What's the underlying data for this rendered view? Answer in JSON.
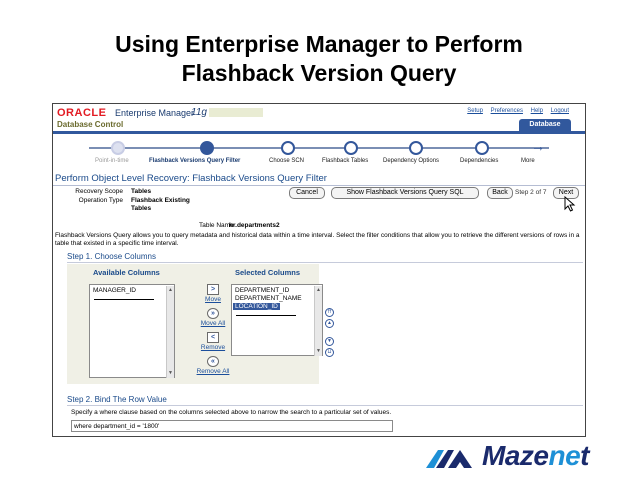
{
  "slide": {
    "title_line1": "Using Enterprise Manager to Perform",
    "title_line2": "Flashback Version Query"
  },
  "em_header": {
    "logo": "ORACLE",
    "product": "Enterprise Manager",
    "version": "11g",
    "subtitle": "Database Control",
    "links": [
      "Setup",
      "Preferences",
      "Help",
      "Logout"
    ],
    "tab": "Database"
  },
  "train": {
    "steps": [
      {
        "label": "Point-in-time",
        "state": "visited"
      },
      {
        "label": "Flashback Versions Query Filter",
        "state": "active"
      },
      {
        "label": "Choose SCN",
        "state": "pending"
      },
      {
        "label": "Flashback Tables",
        "state": "pending"
      },
      {
        "label": "Dependency Options",
        "state": "pending"
      },
      {
        "label": "Dependencies",
        "state": "pending"
      },
      {
        "label": "More",
        "state": "pending"
      }
    ]
  },
  "page": {
    "title": "Perform Object Level Recovery: Flashback Versions Query Filter",
    "recovery_scope_label": "Recovery Scope",
    "recovery_scope_value": "Tables",
    "operation_type_label": "Operation Type",
    "operation_type_value_1": "Flashback Existing",
    "operation_type_value_2": "Tables",
    "buttons": {
      "cancel": "Cancel",
      "show_sql": "Show Flashback Versions Query SQL",
      "back": "Back",
      "step_of": "Step 2 of 7",
      "next": "Next"
    },
    "table_name_label": "Table Name",
    "table_name_value": "hr.departments2",
    "description": "Flashback Versions Query allows you to query metadata and historical data within a time interval. Select the filter conditions that allow you to retrieve the different versions of rows in a table that existed in a specific time interval."
  },
  "step1": {
    "heading": "Step 1. Choose Columns",
    "available_label": "Available Columns",
    "selected_label": "Selected Columns",
    "available": [
      "MANAGER_ID"
    ],
    "selected": [
      "DEPARTMENT_ID",
      "DEPARTMENT_NAME",
      "LOCATION_ID"
    ],
    "selected_highlight_index": 2,
    "move": "Move",
    "move_all": "Move All",
    "remove": "Remove",
    "remove_all": "Remove All"
  },
  "step2": {
    "heading": "Step 2. Bind The Row Value",
    "instruction": "Specify a where clause based on the columns selected above to narrow the search to a particular set of values.",
    "where_value": "where department_id = '1800'"
  },
  "brand": {
    "name_part1": "Maze",
    "name_part2": "ne",
    "name_part3": "t",
    "color_dark": "#1a2a6c",
    "color_light": "#1e90d6"
  },
  "colors": {
    "oracle_red": "#e21a22",
    "em_blue": "#31589d",
    "heading_blue": "#1a4a8a"
  }
}
